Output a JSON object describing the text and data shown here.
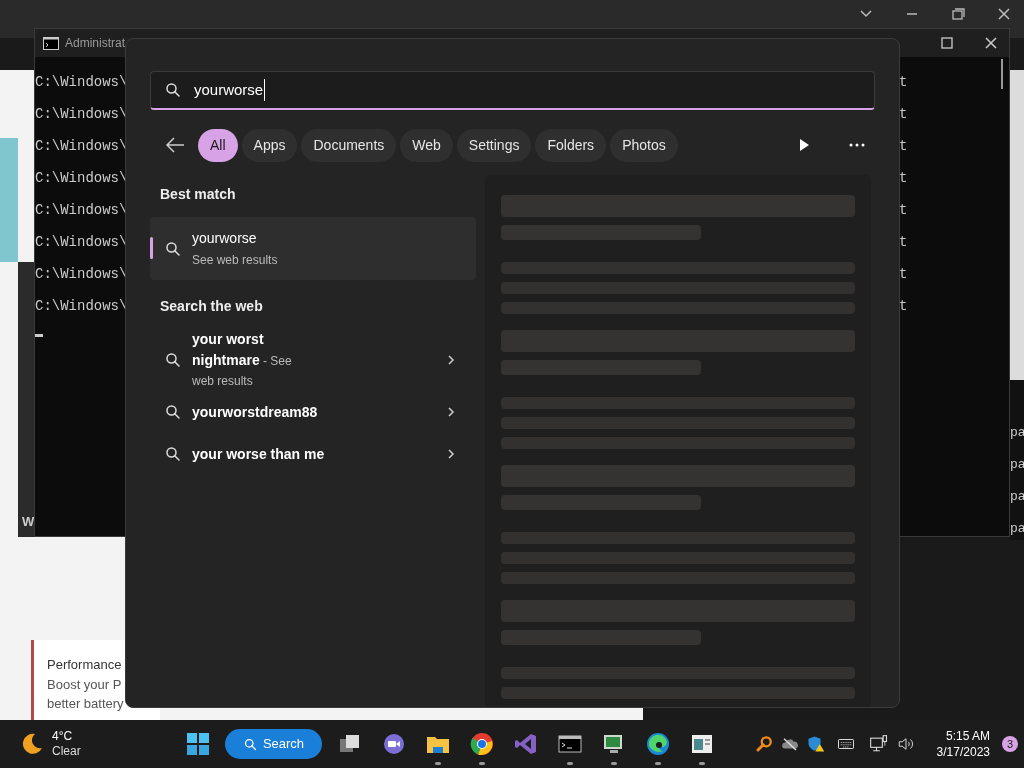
{
  "console": {
    "title": "Administrat",
    "lines": [
      {
        "left": "C:\\Windows\\",
        "right": "t"
      },
      {
        "left": "C:\\Windows\\",
        "right": "t"
      },
      {
        "left": "C:\\Windows\\",
        "right": "t"
      },
      {
        "left": "C:\\Windows\\",
        "right": "t"
      },
      {
        "left": "C:\\Windows\\",
        "right": "t"
      },
      {
        "left": "C:\\Windows\\",
        "right": "t"
      },
      {
        "left": "C:\\Windows\\",
        "right": "t"
      },
      {
        "left": "C:\\Windows\\",
        "right": "t"
      }
    ]
  },
  "side_window": {
    "lines": [
      "pa",
      "pa",
      "pa",
      "pa"
    ]
  },
  "left_window": {
    "letter": "W"
  },
  "notification_card": {
    "title": "Performance",
    "lines": [
      "Boost your P",
      "better battery"
    ]
  },
  "search": {
    "query": "yourworse",
    "filters": [
      {
        "label": "All",
        "selected": true
      },
      {
        "label": "Apps",
        "selected": false
      },
      {
        "label": "Documents",
        "selected": false
      },
      {
        "label": "Web",
        "selected": false
      },
      {
        "label": "Settings",
        "selected": false
      },
      {
        "label": "Folders",
        "selected": false
      },
      {
        "label": "Photos",
        "selected": false
      }
    ],
    "best_match": {
      "heading": "Best match",
      "title": "yourworse",
      "subtitle": "See web results",
      "selected": true
    },
    "web": {
      "heading": "Search the web",
      "results": [
        {
          "text": "**your worst nightmare** - See web results",
          "kind": "rich"
        },
        {
          "text": "yourworstdream88",
          "kind": "plain"
        },
        {
          "text": "your worse than me",
          "kind": "plain"
        }
      ]
    }
  },
  "taskbar": {
    "weather": {
      "temp": "4°C",
      "condition": "Clear"
    },
    "search_label": "Search",
    "apps": [
      {
        "kind": "taskview",
        "running": false
      },
      {
        "kind": "meet",
        "running": false
      },
      {
        "kind": "explorer",
        "running": true
      },
      {
        "kind": "chrome",
        "running": true
      },
      {
        "kind": "vs",
        "running": false
      },
      {
        "kind": "terminal",
        "running": true
      },
      {
        "kind": "monitor",
        "running": true
      },
      {
        "kind": "edge",
        "running": true
      },
      {
        "kind": "window",
        "running": true
      }
    ],
    "clock": {
      "time": "5:15 AM",
      "date": "3/17/2023"
    },
    "notifications": "3"
  }
}
